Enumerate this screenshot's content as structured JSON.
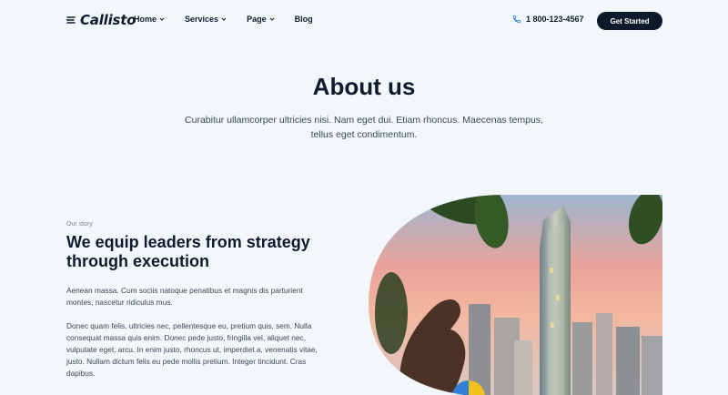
{
  "brand": {
    "logo_text": "Callisto"
  },
  "nav": {
    "items": [
      {
        "label": "Home",
        "has_dropdown": true
      },
      {
        "label": "Services",
        "has_dropdown": true
      },
      {
        "label": "Page",
        "has_dropdown": true
      },
      {
        "label": "Blog",
        "has_dropdown": false
      }
    ]
  },
  "contact": {
    "phone": "1 800-123-4567",
    "icon": "phone-icon"
  },
  "header": {
    "cta_label": "Get Started"
  },
  "hero": {
    "title": "About us",
    "subtitle": "Curabitur ullamcorper ultricies nisi. Nam eget dui. Etiam rhoncus. Maecenas tempus, tellus eget condimentum."
  },
  "story": {
    "eyebrow": "Our story",
    "heading": "We equip leaders from strategy through execution",
    "paragraph1": "Aenean massa. Cum sociis natoque penatibus et magnis dis parturient montes, nascetur ridiculus mus.",
    "paragraph2": "Donec quam felis, ultricies nec, pellentesque eu, pretium quis, sem. Nulla consequat massa quis enim. Donec pede justo, fringilla vel, aliquet nec, vulputate eget, arcu. In enim justo, rhoncus ut, imperdiet a, venenatis vitae, justo. Nullam dictum felis eu pede mollis pretium. Integer tincidunt. Cras dapibus."
  },
  "colors": {
    "background": "#f2f7fb",
    "primary_dark": "#0c1a2b",
    "text_body": "#3c4656",
    "accent_blue": "#2f7fd8",
    "accent_yellow": "#f2c21b"
  }
}
